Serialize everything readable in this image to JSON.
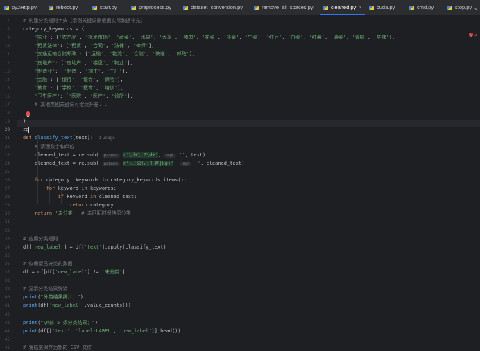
{
  "tabs": [
    {
      "name": "py2Http.py",
      "active": false
    },
    {
      "name": "reboot.py",
      "active": false
    },
    {
      "name": "start.py",
      "active": false
    },
    {
      "name": "preprocess.py",
      "active": false
    },
    {
      "name": "dataset_conversion.py",
      "active": false
    },
    {
      "name": "remove_all_spaces.py",
      "active": false
    },
    {
      "name": "cleaned.py",
      "active": true
    },
    {
      "name": "cuda.py",
      "active": false
    },
    {
      "name": "cmd.py",
      "active": false
    },
    {
      "name": "stop.py",
      "active": false
    }
  ],
  "tab_close_glyph": "×",
  "more_glyph": "⌄",
  "error_count": "2",
  "current_line": "20",
  "lines": [
    {
      "n": "7",
      "t": "# 构建分类规则字典（示例关键词需根据实际数据补充）"
    },
    {
      "n": "8",
      "t": "category_keywords = {"
    },
    {
      "n": "9",
      "t": "    '农业': ['农产品', '批发市场', '蔬菜', '水果', '大米', '猪肉', '花菜', '韭菜', '生菜', '红豆', '白菜', '红薯', '油菜', '青椒', '辛辣'],"
    },
    {
      "n": "10",
      "t": "    '租赁法律': ['租赁', '合同', '法律', '律师'],"
    },
    {
      "n": "11",
      "t": "    '交通运输仓储邮政': ['运输', '物流', '仓储', '快递', '邮政'],"
    },
    {
      "n": "12",
      "t": "    '房地产': ['房地产', '楼盘', '物业'],"
    },
    {
      "n": "13",
      "t": "    '制造业': ['制造', '加工', '工厂'],"
    },
    {
      "n": "14",
      "t": "    '金融': ['银行', '证券', '保险'],"
    },
    {
      "n": "15",
      "t": "    '教育': ['学校', '教育', '培训'],"
    },
    {
      "n": "16",
      "t": "    '卫生医疗': ['医院', '医疗', '诊所'],"
    },
    {
      "n": "17",
      "t": "    # 其他类别关键词可继续补充..."
    },
    {
      "n": "18",
      "t": ""
    },
    {
      "n": "19",
      "t": "}"
    },
    {
      "n": "20",
      "t": "zg"
    },
    {
      "n": "21",
      "t": "def classify_text(text):"
    },
    {
      "n": "22",
      "t": "    # 清理数字和单位"
    },
    {
      "n": "23",
      "t": "    cleaned_text = re.sub("
    },
    {
      "n": "24",
      "t": "    cleaned_text = re.sub("
    },
    {
      "n": "25",
      "t": ""
    },
    {
      "n": "26",
      "t": "    for category, keywords in category_keywords.items():"
    },
    {
      "n": "27",
      "t": "        for keyword in keywords:"
    },
    {
      "n": "28",
      "t": "            if keyword in cleaned_text:"
    },
    {
      "n": "29",
      "t": "                return category"
    },
    {
      "n": "30",
      "t": "    return '未分类'  # 未匹配时保持原分类"
    },
    {
      "n": "31",
      "t": ""
    },
    {
      "n": "32",
      "t": ""
    },
    {
      "n": "33",
      "t": "# 应用分类规则"
    },
    {
      "n": "34",
      "t": "df['new_label'] = df['text'].apply(classify_text)"
    },
    {
      "n": "35",
      "t": ""
    },
    {
      "n": "36",
      "t": "# 仅保留已分类的数据"
    },
    {
      "n": "37",
      "t": "df = df[df['new_label'] != '未分类']"
    },
    {
      "n": "38",
      "t": ""
    },
    {
      "n": "39",
      "t": "# 显示分类结果统计"
    },
    {
      "n": "40",
      "t": "print(\"分类结果统计：\")"
    },
    {
      "n": "41",
      "t": "print(df['new_label'].value_counts())"
    },
    {
      "n": "42",
      "t": ""
    },
    {
      "n": "43",
      "t": "print(\"\\n前 5 条分类结果：\")"
    },
    {
      "n": "44",
      "t": "print(df[['text', 'label:LABEL', 'new_label']].head())"
    },
    {
      "n": "45",
      "t": ""
    },
    {
      "n": "46",
      "t": "# 将结果保存为新的 CSV 文件"
    }
  ],
  "usage_hint": "1 usage",
  "sub1": {
    "hint_pattern": "pattern:",
    "pattern": "r'\\d+\\.?\\d+'",
    "hint_repl": "repl:",
    "repl": "''",
    "tail": ", text)"
  },
  "sub2": {
    "hint_pattern": "pattern:",
    "pattern": "r'元(公斤|千克|kg)'",
    "hint_repl": "repl:",
    "repl": "''",
    "tail": ", cleaned_text)"
  }
}
